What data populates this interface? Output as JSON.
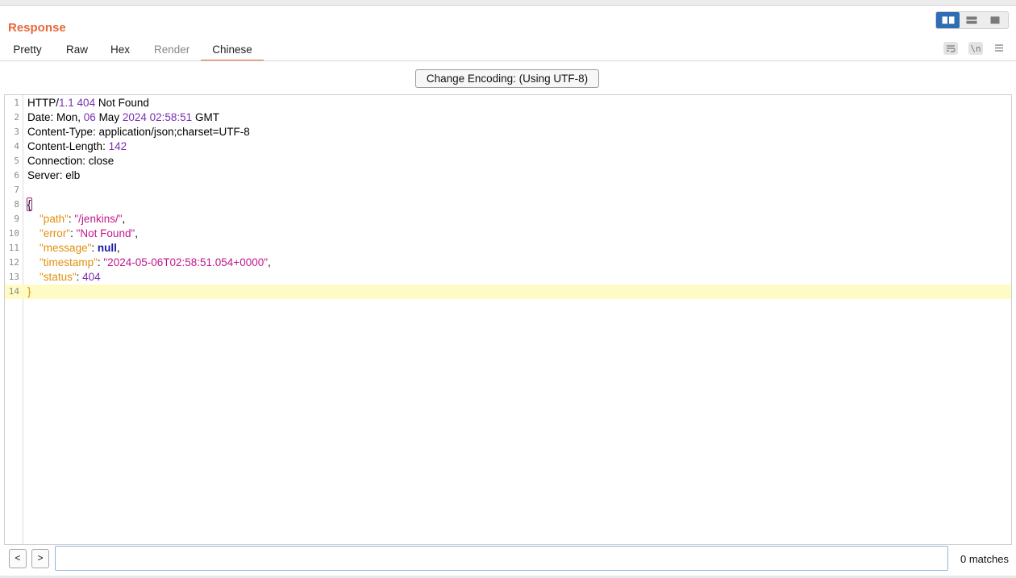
{
  "panel": {
    "title": "Response"
  },
  "tabs": [
    {
      "label": "Pretty",
      "state": "normal"
    },
    {
      "label": "Raw",
      "state": "normal"
    },
    {
      "label": "Hex",
      "state": "normal"
    },
    {
      "label": "Render",
      "state": "disabled"
    },
    {
      "label": "Chinese",
      "state": "active"
    }
  ],
  "view_modes": [
    "split-horizontal-icon",
    "split-vertical-icon",
    "single-panel-icon"
  ],
  "view_mode_selected": "split-horizontal-icon",
  "toolbar": {
    "wrap_icon": "wrap-lines-icon",
    "newline_label": "\\n",
    "menu_icon": "hamburger-menu-icon"
  },
  "encoding": {
    "label": "Change Encoding: (Using UTF-8)"
  },
  "editor": {
    "highlighted_line": 14,
    "lines": [
      {
        "n": "1",
        "text": "HTTP/1.1 404 Not Found"
      },
      {
        "n": "2",
        "text": "Date: Mon, 06 May 2024 02:58:51 GMT"
      },
      {
        "n": "3",
        "text": "Content-Type: application/json;charset=UTF-8"
      },
      {
        "n": "4",
        "text": "Content-Length: 142"
      },
      {
        "n": "5",
        "text": "Connection: close"
      },
      {
        "n": "6",
        "text": "Server: elb"
      },
      {
        "n": "7",
        "text": ""
      },
      {
        "n": "8",
        "text": "{"
      },
      {
        "n": "9",
        "text": "  \"path\": \"/jenkins/\","
      },
      {
        "n": "10",
        "text": "  \"error\": \"Not Found\","
      },
      {
        "n": "11",
        "text": "  \"message\": null,"
      },
      {
        "n": "12",
        "text": "  \"timestamp\": \"2024-05-06T02:58:51.054+0000\","
      },
      {
        "n": "13",
        "text": "  \"status\": 404"
      },
      {
        "n": "14",
        "text": "}"
      }
    ]
  },
  "search": {
    "prev_label": "<",
    "next_label": ">",
    "value": "",
    "placeholder": "",
    "matches_label": "0 matches"
  },
  "colors": {
    "accent": "#e8683a",
    "number": "#7a2fb3",
    "json_key": "#e0900c",
    "json_string": "#c2188a",
    "keyword": "#1a1aa6",
    "highlight_line": "#fefbc4",
    "view_toggle_selected": "#2f6db5"
  }
}
